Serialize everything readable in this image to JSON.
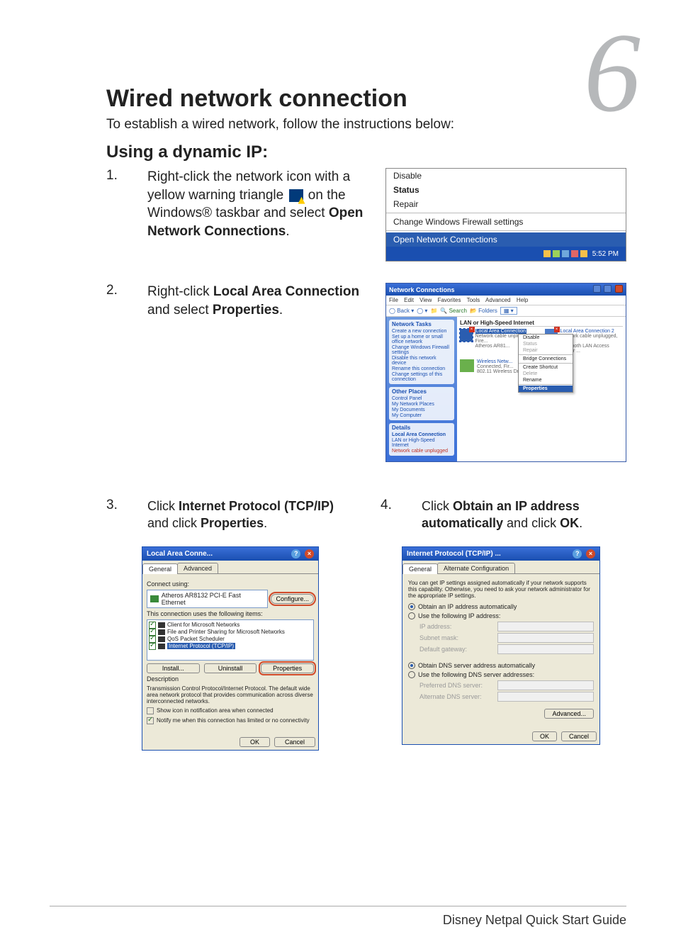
{
  "chapter_number": "6",
  "title": "Wired network connection",
  "intro": "To establish a wired network, follow the instructions below:",
  "subhead": "Using a dynamic IP:",
  "steps": {
    "s1": {
      "num": "1.",
      "text_a": "Right-click the network icon with a yellow warning triangle ",
      "text_b": " on the Windows® taskbar and select ",
      "bold": "Open Network Connections",
      "text_c": "."
    },
    "s2": {
      "num": "2.",
      "text_a": "Right-click ",
      "bold1": "Local Area Connection",
      "text_b": " and select ",
      "bold2": "Properties",
      "text_c": "."
    },
    "s3": {
      "num": "3.",
      "text_a": "Click ",
      "bold1": "Internet Protocol (TCP/IP)",
      "text_b": " and click ",
      "bold2": "Properties",
      "text_c": "."
    },
    "s4": {
      "num": "4.",
      "text_a": "Click ",
      "bold1": "Obtain an IP address automatically",
      "text_b": " and click ",
      "bold2": "OK",
      "text_c": "."
    }
  },
  "ctx_menu": {
    "disable": "Disable",
    "status": "Status",
    "repair": "Repair",
    "firewall": "Change Windows Firewall settings",
    "open_nc": "Open Network Connections",
    "clock": "5:52 PM"
  },
  "nc_window": {
    "title": "Network Connections",
    "menu": {
      "file": "File",
      "edit": "Edit",
      "view": "View",
      "favorites": "Favorites",
      "tools": "Tools",
      "advanced": "Advanced",
      "help": "Help"
    },
    "toolbar": {
      "back": "Back",
      "search": "Search",
      "folders": "Folders"
    },
    "side": {
      "tasks_hdr": "Network Tasks",
      "tasks": [
        "Create a new connection",
        "Set up a home or small office network",
        "Change Windows Firewall settings",
        "Disable this network device",
        "Rename this connection",
        "Change settings of this connection"
      ],
      "places_hdr": "Other Places",
      "places": [
        "Control Panel",
        "My Network Places",
        "My Documents",
        "My Computer"
      ],
      "details_hdr": "Details",
      "details": [
        "Local Area Connection",
        "LAN or High-Speed Internet",
        "Network cable unplugged"
      ]
    },
    "cat": "LAN or High-Speed Internet",
    "conn1": {
      "name": "Local Area Connection",
      "sub1": "Network cable unplugged, Fire...",
      "sub2": "Atheros AR81..."
    },
    "conn2": {
      "name": "Local Area Connection 2",
      "sub1": "Network cable unplugged, Fire...",
      "sub2": "Bluetooth LAN Access Server ..."
    },
    "conn3": {
      "name": "Wireless Netw...",
      "sub1": "Connected, Fir...",
      "sub2": "802.11 Wireless Driv..."
    },
    "ctx": {
      "disable": "Disable",
      "status": "Status",
      "repair": "Repair",
      "bridge": "Bridge Connections",
      "shortcut": "Create Shortcut",
      "delete": "Delete",
      "rename": "Rename",
      "properties": "Properties"
    }
  },
  "lac_dialog": {
    "title": "Local Area Conne...",
    "tab_general": "General",
    "tab_advanced": "Advanced",
    "connect_using": "Connect using:",
    "adapter": "Atheros AR8132 PCI-E Fast Ethernet",
    "configure": "Configure...",
    "uses_items": "This connection uses the following items:",
    "items": [
      "Client for Microsoft Networks",
      "File and Printer Sharing for Microsoft Networks",
      "QoS Packet Scheduler",
      "Internet Protocol (TCP/IP)"
    ],
    "install": "Install...",
    "uninstall": "Uninstall",
    "properties": "Properties",
    "desc_hdr": "Description",
    "desc": "Transmission Control Protocol/Internet Protocol. The default wide area network protocol that provides communication across diverse interconnected networks.",
    "show_icon": "Show icon in notification area when connected",
    "notify": "Notify me when this connection has limited or no connectivity",
    "ok": "OK",
    "cancel": "Cancel"
  },
  "tcp_dialog": {
    "title": "Internet Protocol (TCP/IP) ...",
    "tab_general": "General",
    "tab_alt": "Alternate Configuration",
    "explain": "You can get IP settings assigned automatically if your network supports this capability. Otherwise, you need to ask your network administrator for the appropriate IP settings.",
    "r_auto_ip": "Obtain an IP address automatically",
    "r_use_ip": "Use the following IP address:",
    "ip": "IP address:",
    "subnet": "Subnet mask:",
    "gateway": "Default gateway:",
    "r_auto_dns": "Obtain DNS server address automatically",
    "r_use_dns": "Use the following DNS server addresses:",
    "pref_dns": "Preferred DNS server:",
    "alt_dns": "Alternate DNS server:",
    "advanced": "Advanced...",
    "ok": "OK",
    "cancel": "Cancel"
  },
  "footer": "Disney Netpal Quick Start Guide"
}
